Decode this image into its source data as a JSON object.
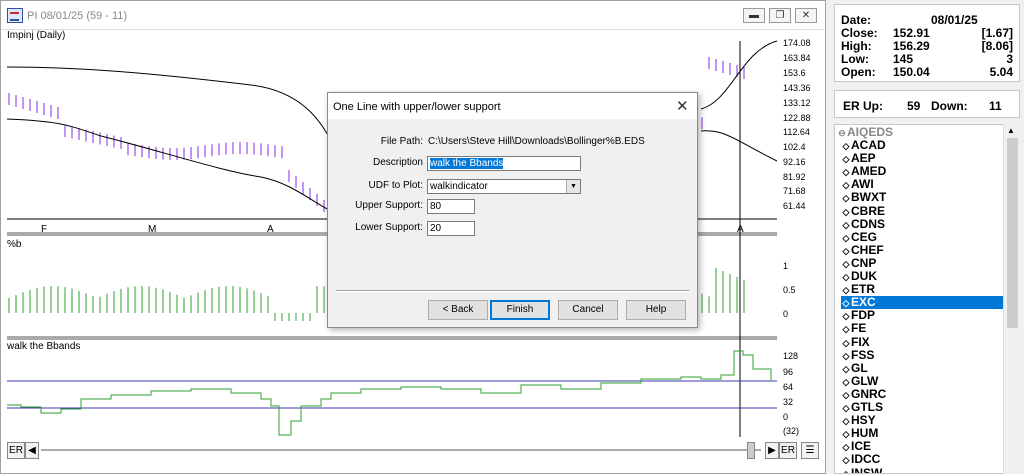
{
  "window": {
    "title": "PI 08/01/25 (59 - 11)"
  },
  "price_panel": {
    "label": "Impinj (Daily)",
    "y_ticks": [
      "174.08",
      "163.84",
      "153.6",
      "143.36",
      "133.12",
      "122.88",
      "112.64",
      "102.4",
      "92.16",
      "81.92",
      "71.68",
      "61.44"
    ],
    "x_ticks": [
      "F",
      "M",
      "A",
      "A"
    ]
  },
  "pctb_panel": {
    "label": "%b",
    "y_ticks": [
      "1",
      "0.5",
      "0"
    ]
  },
  "walk_panel": {
    "label": "walk the Bbands",
    "y_ticks": [
      "128",
      "96",
      "64",
      "32",
      "0",
      "(32)"
    ]
  },
  "scroll": {
    "left_label": "ER",
    "right_label": "ER"
  },
  "info": {
    "date_label": "Date:",
    "date_value": "08/01/25",
    "close_label": "Close:",
    "close_value": "152.91",
    "close_change": "[1.67]",
    "high_label": "High:",
    "high_value": "156.29",
    "high_change": "[8.06]",
    "low_label": "Low:",
    "low_value": "145",
    "low_change": "3",
    "open_label": "Open:",
    "open_value": "150.04",
    "open_change": "5.04"
  },
  "er": {
    "up_label": "ER Up:",
    "up_value": "59",
    "down_label": "Down:",
    "down_value": "11"
  },
  "list": {
    "header": "AIQEDS",
    "items": [
      "ACAD",
      "AEP",
      "AMED",
      "AWI",
      "BWXT",
      "CBRE",
      "CDNS",
      "CEG",
      "CHEF",
      "CNP",
      "DUK",
      "ETR",
      "EXC",
      "FDP",
      "FE",
      "FIX",
      "FSS",
      "GL",
      "GLW",
      "GNRC",
      "GTLS",
      "HSY",
      "HUM",
      "ICE",
      "IDCC",
      "INSW"
    ],
    "selected": "EXC"
  },
  "dialog": {
    "title": "One Line with upper/lower support",
    "file_path_label": "File Path:",
    "file_path_value": "C:\\Users\\Steve Hill\\Downloads\\Bollinger%B.EDS",
    "description_label": "Description",
    "description_value": "walk the Bbands",
    "udf_label": "UDF to Plot:",
    "udf_value": "walkindicator",
    "upper_label": "Upper Support:",
    "upper_value": "80",
    "lower_label": "Lower Support:",
    "lower_value": "20",
    "back_label": "< Back",
    "finish_label": "Finish",
    "cancel_label": "Cancel",
    "help_label": "Help"
  },
  "colors": {
    "price_bar": "#8a2be2",
    "band": "#000000",
    "pctb_bar": "#2ca02c",
    "walk_line": "#2ca02c",
    "support_line": "#3a3ab0",
    "selection": "#0078d7"
  }
}
